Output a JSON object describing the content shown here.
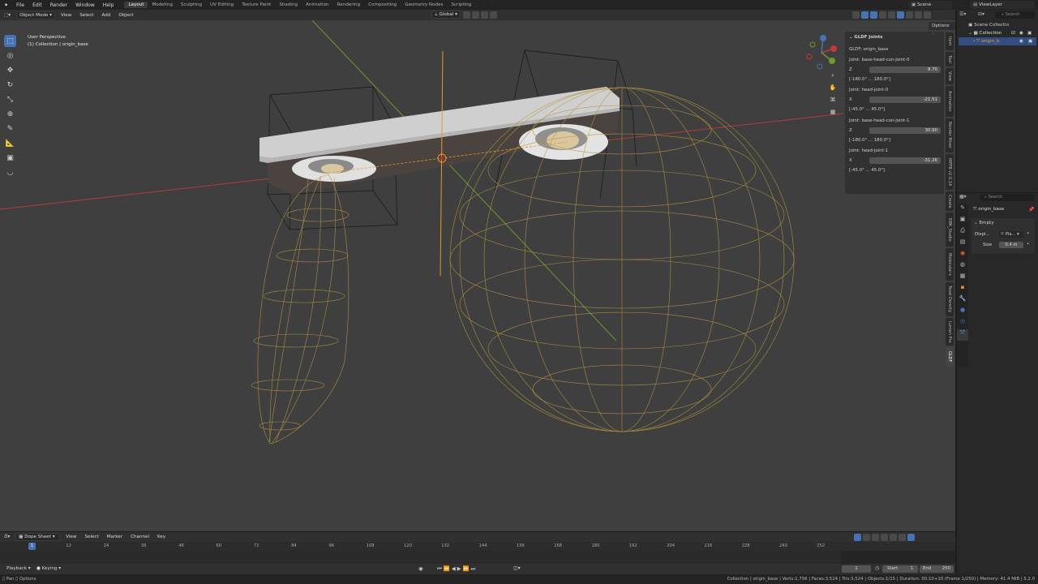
{
  "menus": [
    "File",
    "Edit",
    "Render",
    "Window",
    "Help"
  ],
  "workspaces": [
    "Layout",
    "Modeling",
    "Sculpting",
    "UV Editing",
    "Texture Paint",
    "Shading",
    "Animation",
    "Rendering",
    "Compositing",
    "Geometry Nodes",
    "Scripting"
  ],
  "active_workspace": "Layout",
  "scene_name": "Scene",
  "view_layer": "ViewLayer",
  "viewport_header": {
    "mode": "Object Mode",
    "menus": [
      "View",
      "Select",
      "Add",
      "Object"
    ],
    "orientation": "Global",
    "options": "Options"
  },
  "viewport": {
    "perspective": "User Perspective",
    "collection_info": "(1) Collection | origin_base"
  },
  "gldf_panel": {
    "title": "GLDF Joints",
    "object": "GLDF: origin_base",
    "joints": [
      {
        "name": "Joint: base-head-con-joint-0",
        "axis": "Z",
        "value": "8.70",
        "range": "[-180.0° ... 180.0°]"
      },
      {
        "name": "Joint: head-joint-0",
        "axis": "X",
        "value": "-21.51",
        "range": "[-45.0° ... 45.0°]"
      },
      {
        "name": "Joint: base-head-con-joint-1",
        "axis": "Z",
        "value": "30.90",
        "range": "[-180.0° ... 180.0°]"
      },
      {
        "name": "Joint: head-joint-1",
        "axis": "X",
        "value": "-31.26",
        "range": "[-45.0° ... 45.0°]"
      }
    ]
  },
  "side_tabs": [
    "Item",
    "Tool",
    "View",
    "Animation",
    "Render Mixer",
    "MPFB v2.0.14",
    "Create",
    "RBK_Studio",
    "Molecular+",
    "Texel Density",
    "Lumen Pro",
    "GLDF"
  ],
  "outliner": {
    "search_placeholder": "Search",
    "scene_collection": "Scene Collectio",
    "collection": "Collection",
    "object": "origin_b"
  },
  "properties": {
    "search_placeholder": "Search",
    "object_name": "origin_base",
    "section": "Empty",
    "display_label": "Displ...",
    "display_value": "Pla...",
    "size_label": "Size",
    "size_value": "0.4 m"
  },
  "timeline": {
    "editor": "Dope Sheet",
    "menus": [
      "View",
      "Select",
      "Marker",
      "Channel",
      "Key"
    ],
    "ticks": [
      "1",
      "12",
      "24",
      "36",
      "48",
      "60",
      "72",
      "84",
      "96",
      "108",
      "120",
      "132",
      "144",
      "156",
      "168",
      "180",
      "192",
      "204",
      "216",
      "228",
      "240",
      "252"
    ],
    "current_frame": "1",
    "playback": "Playback",
    "keying": "Keying",
    "frame_field": "1",
    "start_label": "Start",
    "start": "1",
    "end_label": "End",
    "end": "250"
  },
  "statusbar": {
    "left_pan": "Pan",
    "left_options": "Options",
    "right": "Collection | origin_base | Verts:1,756 | Faces:3,524 | Tris:3,524 | Objects:1/15 | Duration: 00:10+10 (Frame 1/250) | Memory: 41.4 MiB | 5.2.0"
  },
  "colors": {
    "accent": "#4772b3",
    "wire": "#b8963e",
    "x_axis": "#c03a3a",
    "y_axis": "#6e9b2e",
    "empty": "#e69a22"
  }
}
